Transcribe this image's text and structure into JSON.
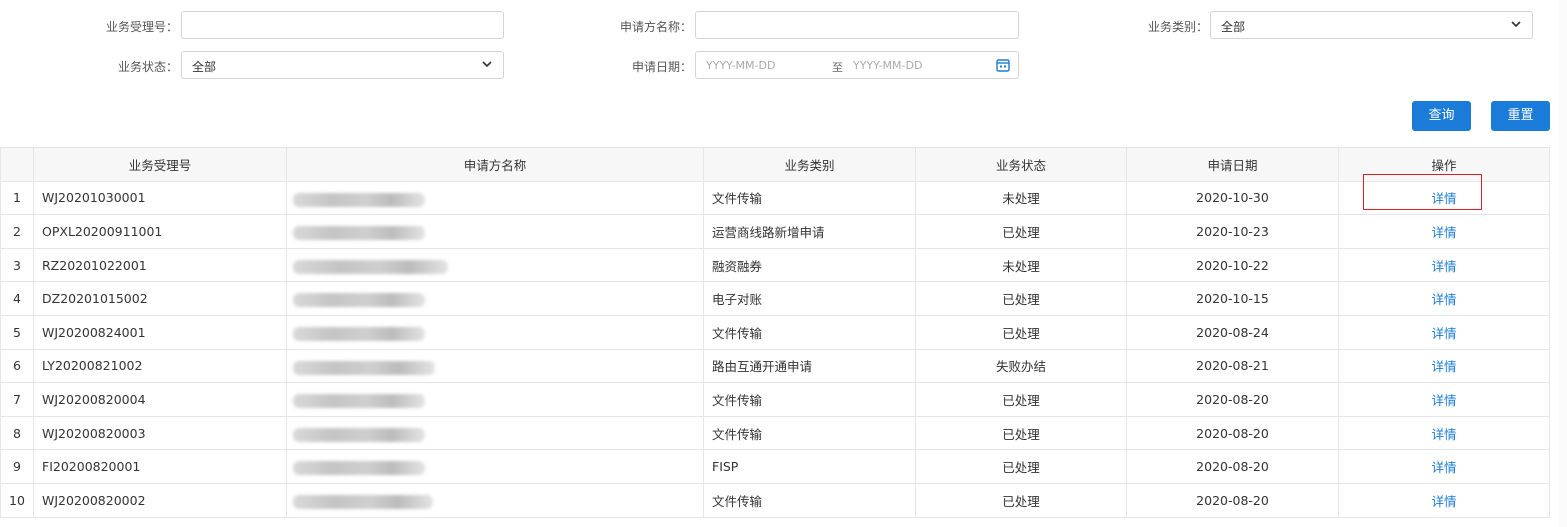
{
  "filters": {
    "accept_no_label": "业务受理号：",
    "accept_no_value": "",
    "applicant_label": "申请方名称：",
    "applicant_value": "",
    "category_label": "业务类别：",
    "category_value": "全部",
    "status_label": "业务状态：",
    "status_value": "全部",
    "date_label": "申请日期：",
    "date_start_placeholder": "YYYY-MM-DD",
    "date_sep": "至",
    "date_end_placeholder": "YYYY-MM-DD"
  },
  "buttons": {
    "query": "查询",
    "reset": "重置"
  },
  "table": {
    "headers": [
      "业务受理号",
      "申请方名称",
      "业务类别",
      "业务状态",
      "申请日期",
      "操作"
    ],
    "detail_label": "详情",
    "rows": [
      {
        "idx": "1",
        "no": "WJ20201030001",
        "category": "文件传输",
        "status": "未处理",
        "date": "2020-10-30"
      },
      {
        "idx": "2",
        "no": "OPXL20200911001",
        "category": "运营商线路新增申请",
        "status": "已处理",
        "date": "2020-10-23"
      },
      {
        "idx": "3",
        "no": "RZ20201022001",
        "category": "融资融券",
        "status": "未处理",
        "date": "2020-10-22"
      },
      {
        "idx": "4",
        "no": "DZ20201015002",
        "category": "电子对账",
        "status": "已处理",
        "date": "2020-10-15"
      },
      {
        "idx": "5",
        "no": "WJ20200824001",
        "category": "文件传输",
        "status": "已处理",
        "date": "2020-08-24"
      },
      {
        "idx": "6",
        "no": "LY20200821002",
        "category": "路由互通开通申请",
        "status": "失败办结",
        "date": "2020-08-21"
      },
      {
        "idx": "7",
        "no": "WJ20200820004",
        "category": "文件传输",
        "status": "已处理",
        "date": "2020-08-20"
      },
      {
        "idx": "8",
        "no": "WJ20200820003",
        "category": "文件传输",
        "status": "已处理",
        "date": "2020-08-20"
      },
      {
        "idx": "9",
        "no": "FI20200820001",
        "category": "FISP",
        "status": "已处理",
        "date": "2020-08-20"
      },
      {
        "idx": "10",
        "no": "WJ20200820002",
        "category": "文件传输",
        "status": "已处理",
        "date": "2020-08-20"
      }
    ]
  },
  "colors": {
    "accent": "#1a7bd8",
    "highlight": "#e02020"
  }
}
